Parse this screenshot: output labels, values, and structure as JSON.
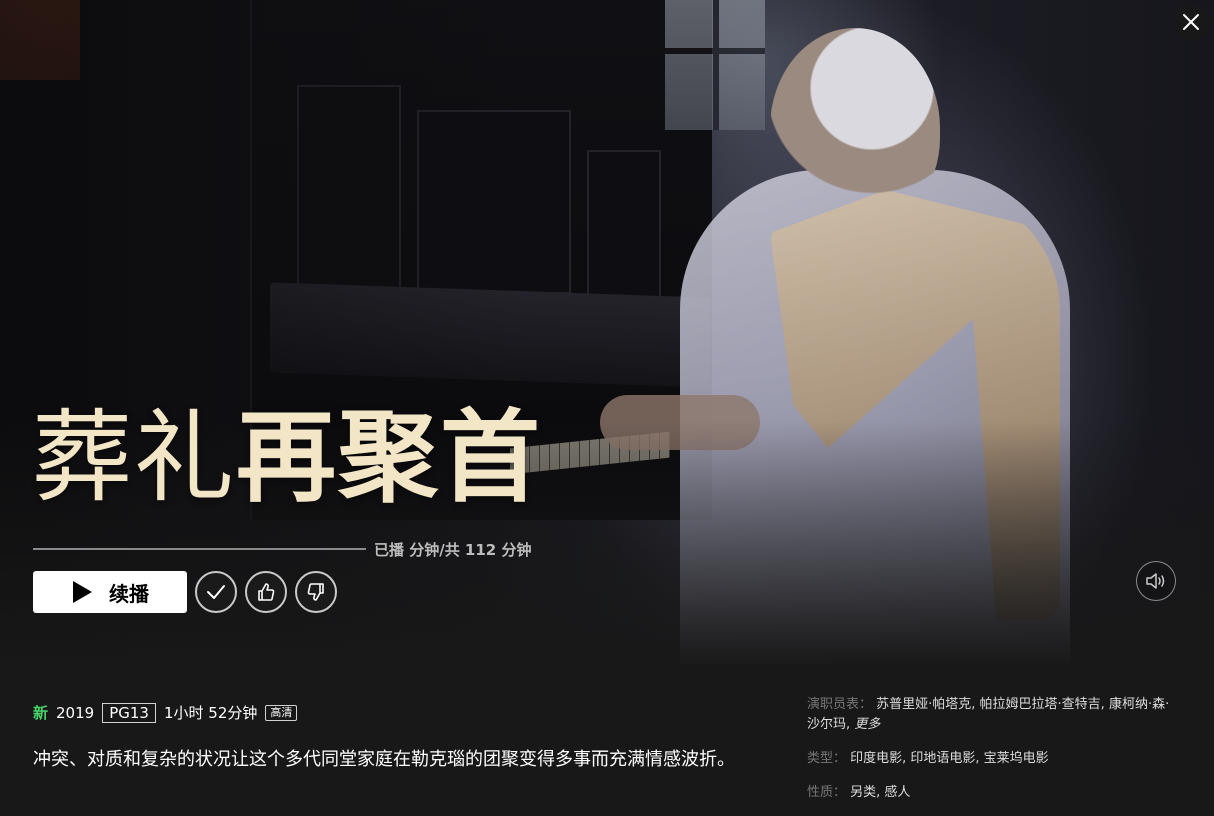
{
  "window": {
    "close_icon": "close-icon"
  },
  "title": {
    "part_light": "葬礼",
    "part_bold": "再聚首"
  },
  "progress": {
    "watched_fraction": 0,
    "text": "已播 分钟/共 112 分钟"
  },
  "actions": {
    "play_label": "续播",
    "play_icon": "play-icon",
    "add_list_icon": "check-icon",
    "like_icon": "thumbs-up-icon",
    "dislike_icon": "thumbs-down-icon",
    "mute_icon": "speaker-icon"
  },
  "meta": {
    "new_badge": "新",
    "year": "2019",
    "rating": "PG13",
    "duration": "1小时 52分钟",
    "quality": "高清"
  },
  "description": "冲突、对质和复杂的状况让这个多代同堂家庭在勒克瑙的团聚变得多事而充满情感波折。",
  "details": {
    "cast_label": "演职员表：",
    "cast_value": "苏普里娅·帕塔克, 帕拉姆巴拉塔·查特吉, 康柯纳·森·沙尔玛, ",
    "cast_more": "更多",
    "genre_label": "类型：",
    "genre_value": "印度电影, 印地语电影, 宝莱坞电影",
    "mood_label": "性质：",
    "mood_value": "另类, 感人"
  },
  "colors": {
    "accent_new": "#46d369",
    "progress_fill": "#e50914",
    "title_color": "#f3e6c6"
  }
}
